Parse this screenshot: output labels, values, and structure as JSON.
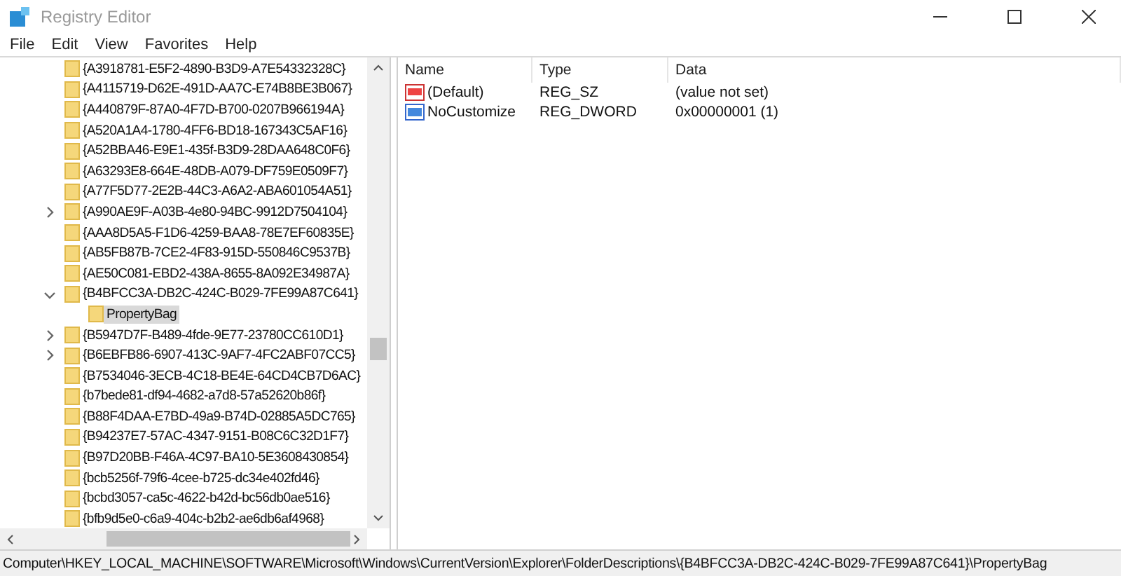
{
  "window": {
    "title": "Registry Editor"
  },
  "menu": [
    "File",
    "Edit",
    "View",
    "Favorites",
    "Help"
  ],
  "tree": [
    {
      "label": "{A3918781-E5F2-4890-B3D9-A7E54332328C}",
      "selected": false
    },
    {
      "label": "{A4115719-D62E-491D-AA7C-E74B8BE3B067}",
      "selected": false
    },
    {
      "label": "{A440879F-87A0-4F7D-B700-0207B966194A}",
      "selected": false
    },
    {
      "label": "{A520A1A4-1780-4FF6-BD18-167343C5AF16}",
      "selected": false
    },
    {
      "label": "{A52BBA46-E9E1-435f-B3D9-28DAA648C0F6}",
      "selected": false
    },
    {
      "label": "{A63293E8-664E-48DB-A079-DF759E0509F7}",
      "selected": false
    },
    {
      "label": "{A77F5D77-2E2B-44C3-A6A2-ABA601054A51}",
      "selected": false
    },
    {
      "label": "{A990AE9F-A03B-4e80-94BC-9912D7504104}",
      "expanded": false,
      "selected": false
    },
    {
      "label": "{AAA8D5A5-F1D6-4259-BAA8-78E7EF60835E}",
      "selected": false
    },
    {
      "label": "{AB5FB87B-7CE2-4F83-915D-550846C9537B}",
      "selected": false
    },
    {
      "label": "{AE50C081-EBD2-438A-8655-8A092E34987A}",
      "selected": false
    },
    {
      "label": "{B4BFCC3A-DB2C-424C-B029-7FE99A87C641}",
      "expanded": true,
      "selected": false,
      "children": [
        {
          "label": "PropertyBag",
          "selected": true
        }
      ]
    },
    {
      "label": "{B5947D7F-B489-4fde-9E77-23780CC610D1}",
      "expanded": false,
      "selected": false
    },
    {
      "label": "{B6EBFB86-6907-413C-9AF7-4FC2ABF07CC5}",
      "expanded": false,
      "selected": false
    },
    {
      "label": "{B7534046-3ECB-4C18-BE4E-64CD4CB7D6AC}",
      "selected": false
    },
    {
      "label": "{b7bede81-df94-4682-a7d8-57a52620b86f}",
      "selected": false
    },
    {
      "label": "{B88F4DAA-E7BD-49a9-B74D-02885A5DC765}",
      "selected": false
    },
    {
      "label": "{B94237E7-57AC-4347-9151-B08C6C32D1F7}",
      "selected": false
    },
    {
      "label": "{B97D20BB-F46A-4C97-BA10-5E3608430854}",
      "selected": false
    },
    {
      "label": "{bcb5256f-79f6-4cee-b725-dc34e402fd46}",
      "selected": false
    },
    {
      "label": "{bcbd3057-ca5c-4622-b42d-bc56db0ae516}",
      "selected": false
    },
    {
      "label": "{bfb9d5e0-c6a9-404c-b2b2-ae6db6af4968}",
      "selected": false
    }
  ],
  "values": {
    "columns": [
      "Name",
      "Type",
      "Data"
    ],
    "rows": [
      {
        "kind": "string",
        "name": "(Default)",
        "type": "REG_SZ",
        "data": "(value not set)"
      },
      {
        "kind": "binary",
        "name": "NoCustomize",
        "type": "REG_DWORD",
        "data": "0x00000001 (1)"
      }
    ]
  },
  "status_bar": "Computer\\HKEY_LOCAL_MACHINE\\SOFTWARE\\Microsoft\\Windows\\CurrentVersion\\Explorer\\FolderDescriptions\\{B4BFCC3A-DB2C-424C-B029-7FE99A87C641}\\PropertyBag"
}
